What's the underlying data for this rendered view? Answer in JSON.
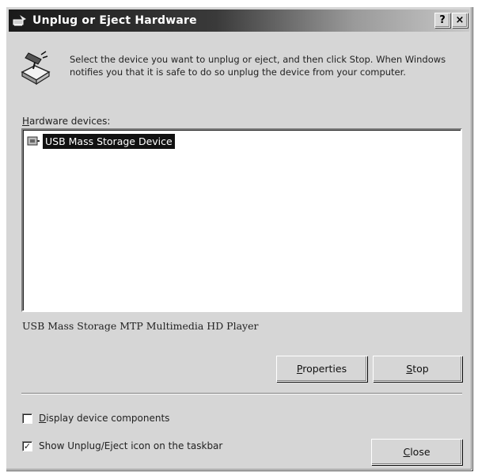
{
  "window": {
    "title": "Unplug or Eject Hardware",
    "help_glyph": "?",
    "close_glyph": "×"
  },
  "instructions": "Select the device you want to unplug or eject, and then click Stop. When Windows notifies you that it is safe to do so unplug the device from your computer.",
  "hardware_label": "Hardware devices:",
  "devices": [
    {
      "label": "USB Mass Storage Device",
      "icon": "usb-device-icon",
      "selected": true
    }
  ],
  "device_description": "USB Mass Storage MTP Multimedia HD Player",
  "buttons": {
    "properties": "Properties",
    "stop": "Stop",
    "close": "Close"
  },
  "options": {
    "display_components": {
      "label": "Display device components",
      "checked": false
    },
    "show_icon": {
      "label": "Show Unplug/Eject icon on the taskbar",
      "checked": true
    }
  }
}
